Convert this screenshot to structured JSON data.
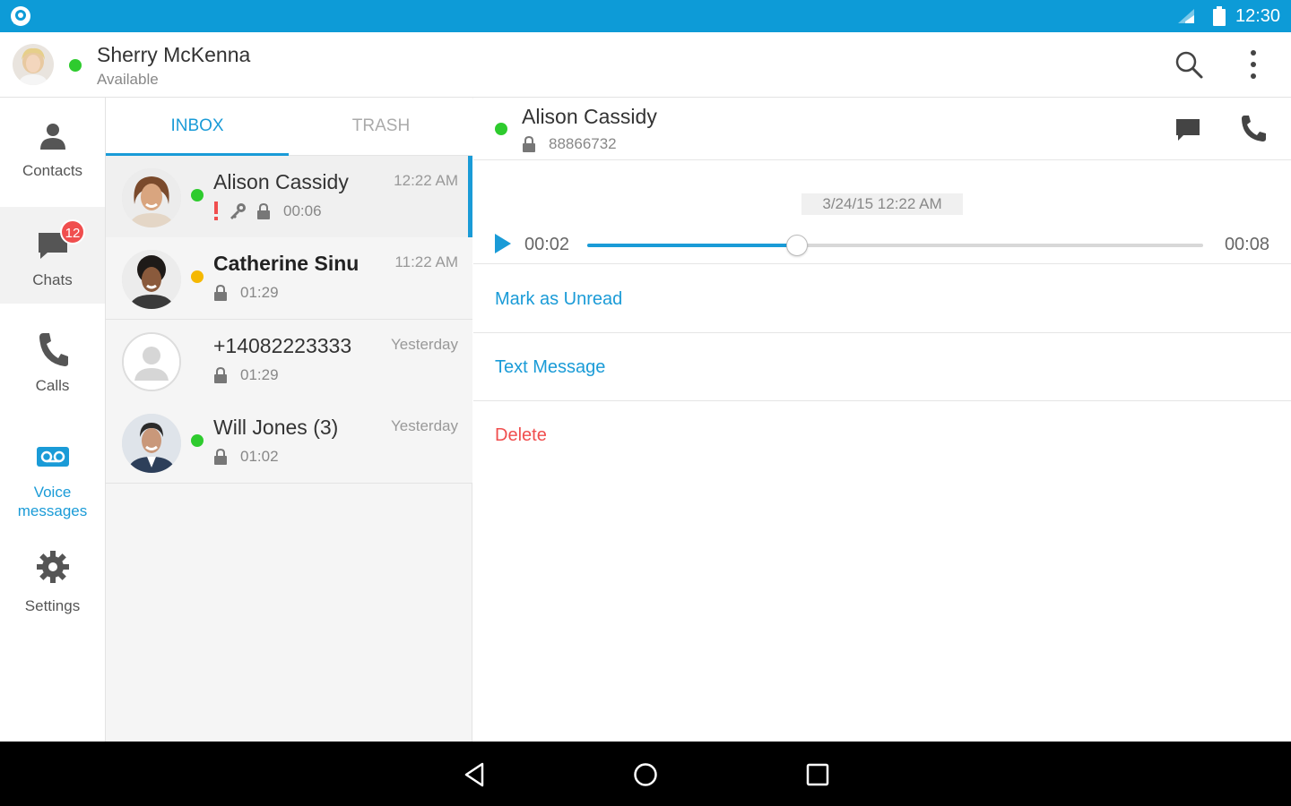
{
  "status_bar": {
    "time": "12:30"
  },
  "header": {
    "user_name": "Sherry McKenna",
    "user_status": "Available",
    "presence_color": "#2ecb2e"
  },
  "nav": {
    "items": [
      {
        "label": "Contacts",
        "icon": "person-icon"
      },
      {
        "label": "Chats",
        "icon": "chat-bubble-icon",
        "badge": "12"
      },
      {
        "label": "Calls",
        "icon": "phone-icon"
      },
      {
        "label": "Voice messages",
        "label_line1": "Voice",
        "label_line2": "messages",
        "icon": "voicemail-icon"
      },
      {
        "label": "Settings",
        "icon": "gear-icon"
      }
    ]
  },
  "tabs": [
    {
      "label": "INBOX",
      "active": true
    },
    {
      "label": "TRASH",
      "active": false
    }
  ],
  "messages": [
    {
      "name": "Alison Cassidy",
      "time": "12:22 AM",
      "duration": "00:06",
      "presence": "#2ecb2e",
      "urgent": true,
      "private": true,
      "bold": false
    },
    {
      "name": "Catherine Sinu",
      "time": "11:22 AM",
      "duration": "01:29",
      "presence": "#f5b800",
      "urgent": false,
      "private": false,
      "bold": true
    },
    {
      "name": "+14082223333",
      "time": "Yesterday",
      "duration": "01:29",
      "presence": null,
      "urgent": false,
      "private": false,
      "bold": false
    },
    {
      "name": "Will Jones (3)",
      "time": "Yesterday",
      "duration": "01:02",
      "presence": "#2ecb2e",
      "urgent": false,
      "private": false,
      "bold": false
    }
  ],
  "detail": {
    "name": "Alison Cassidy",
    "number": "88866732",
    "timestamp": "3/24/15 12:22 AM",
    "player": {
      "current": "00:02",
      "total": "00:08",
      "progress": 0.34
    },
    "actions": {
      "mark_unread": "Mark as Unread",
      "text_message": "Text Message",
      "delete": "Delete"
    }
  },
  "colors": {
    "accent": "#1a9bd7",
    "danger": "#f04e4e",
    "status_bar": "#0d9bd7"
  }
}
